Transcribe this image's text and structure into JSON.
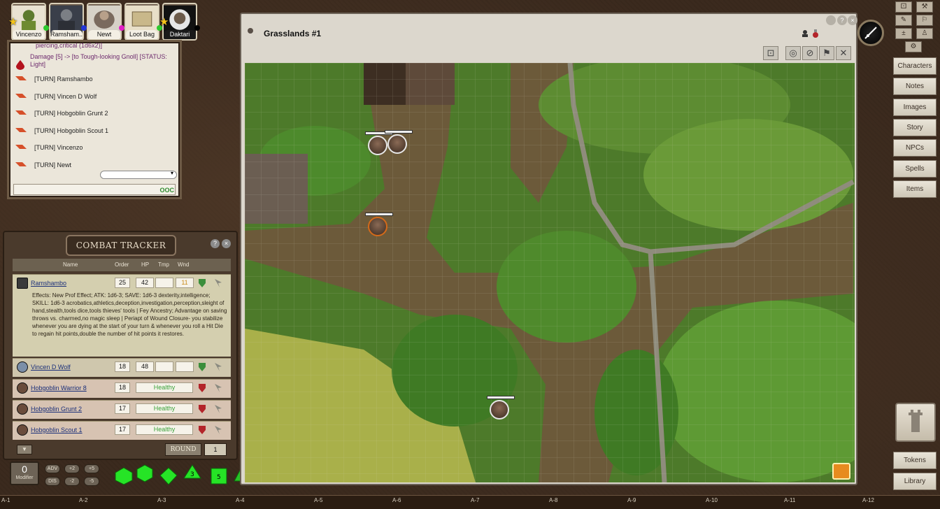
{
  "party": [
    {
      "name": "Vincenzo",
      "star": true,
      "dot": "#2dc92d"
    },
    {
      "name": "Ramsham...",
      "star": false,
      "dot": "#2236d6"
    },
    {
      "name": "Newt",
      "star": false,
      "dot": "#e21fc5"
    },
    {
      "name": "Loot Bag",
      "star": false,
      "dot": "#2dc92d"
    },
    {
      "name": "Daktari",
      "star": true,
      "dot": "#000000"
    }
  ],
  "chat": {
    "top_text_1": "piercing,critical (1d6x2)]",
    "top_text_2": "Damage [5] -> [to Tough-looking Gnoll] [STATUS: Light]",
    "turns": [
      "[TURN] Ramshambo",
      "[TURN] Vincen D Wolf",
      "[TURN] Hobgoblin Grunt 2",
      "[TURN] Hobgoblin Scout 1",
      "[TURN] Vincenzo",
      "[TURN] Newt"
    ],
    "ooc_label": "OOC"
  },
  "combat_tracker": {
    "title": "COMBAT TRACKER",
    "help": "?",
    "close": "×",
    "columns": {
      "name": "Name",
      "order": "Order",
      "hp": "HP",
      "tmp": "Tmp",
      "wnd": "Wnd"
    },
    "active": {
      "name": "Ramshambo",
      "order": "25",
      "hp": "42",
      "tmp": "",
      "wnd": "11",
      "effects": "Effects: New Prof Effect; ATK: 1d6-3; SAVE: 1d6-3 dexterity,intelligence; SKILL: 1d6-3 acrobatics,athletics,deception,investigation,perception,sleight of hand,stealth,tools dice,tools thieves' tools | Fey Ancestry; Advantage on saving throws vs. charmed,no magic sleep | Periapt of Wound Closure- you stabilize whenever you are dying at the start of your turn & whenever you roll a Hit Die to regain hit points,double the number of hit points it restores."
    },
    "rows": [
      {
        "name": "Vincen D Wolf",
        "order": "18",
        "hp": "48",
        "status": "",
        "friendly": true
      },
      {
        "name": "Hobgoblin Warrior 8",
        "order": "18",
        "status": "Healthy",
        "friendly": false
      },
      {
        "name": "Hobgoblin Grunt 2",
        "order": "17",
        "status": "Healthy",
        "friendly": false
      },
      {
        "name": "Hobgoblin Scout 1",
        "order": "17",
        "status": "Healthy",
        "friendly": false
      }
    ],
    "round_label": "ROUND",
    "round_value": "1"
  },
  "map": {
    "title": "Grasslands #1"
  },
  "sidebar": {
    "buttons": [
      "Characters",
      "Notes",
      "Images",
      "Story",
      "NPCs",
      "Spells",
      "Items"
    ],
    "bottom_buttons": [
      "Tokens",
      "Library"
    ]
  },
  "dice_tray": {
    "modifier_value": "0",
    "modifier_label": "Modifier",
    "buttons": [
      "ADV",
      "+2",
      "+5",
      "DIS",
      "-2",
      "-5"
    ],
    "dice_labels": [
      "",
      "",
      "",
      "3",
      "5",
      ""
    ]
  },
  "grid_labels": [
    "A-1",
    "A-2",
    "A-3",
    "A-4",
    "A-5",
    "A-6",
    "A-7",
    "A-8",
    "A-9",
    "A-10",
    "A-11",
    "A-12"
  ],
  "colors": {
    "healthy": "#3aa23a",
    "link": "#1a2f7a",
    "chat_purple": "#6d2a6d",
    "dice_green": "#26e426"
  }
}
